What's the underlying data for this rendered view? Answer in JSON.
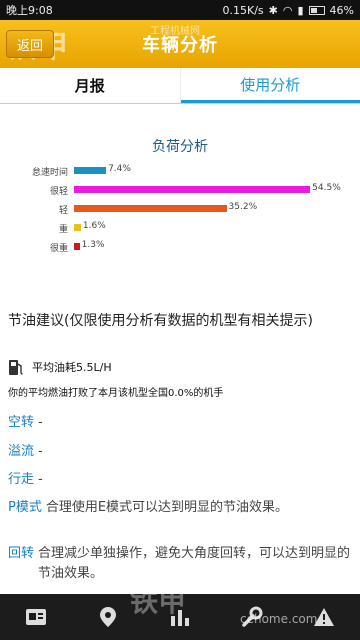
{
  "status_bar": {
    "time": "晚上9:08",
    "network_speed": "0.15K/s",
    "battery": "46%"
  },
  "header": {
    "back_label": "返回",
    "title": "车辆分析",
    "watermark": "铁甲",
    "watermark_sub": "工程机械网"
  },
  "tabs": [
    {
      "label": "月报",
      "selected": false
    },
    {
      "label": "使用分析",
      "selected": true
    }
  ],
  "chart_data": {
    "type": "bar",
    "title": "负荷分析",
    "categories": [
      "怠速时间",
      "很轻",
      "轻",
      "重",
      "很重"
    ],
    "values": [
      7.4,
      54.5,
      35.2,
      1.6,
      1.3
    ],
    "value_labels": [
      "7.4%",
      "54.5%",
      "35.2%",
      "1.6%",
      "1.3%"
    ],
    "colors": [
      "#1a8fc8",
      "#e81be0",
      "#e8571c",
      "#e8c21c",
      "#c81c1c"
    ],
    "orientation": "horizontal",
    "xlim": [
      0,
      60
    ]
  },
  "fuel": {
    "section_title": "节油建议(仅限使用分析有数据的机型有相关提示)",
    "avg_label": "平均油耗5.5L/H",
    "icon": "fuel-pump-icon",
    "compare_text": "你的平均燃油打败了本月该机型全国0.0%的机手"
  },
  "tips": [
    {
      "key": "空转",
      "value": "-"
    },
    {
      "key": "溢流",
      "value": "-"
    },
    {
      "key": "行走",
      "value": "-"
    },
    {
      "key": "P模式",
      "value": "合理使用E模式可以达到明显的节油效果。"
    },
    {
      "key": "回转",
      "value": "合理减少单独操作，避免大角度回转，可以达到明显的节油效果。"
    }
  ],
  "bottom_nav": [
    {
      "icon": "report-icon"
    },
    {
      "icon": "location-icon"
    },
    {
      "icon": "chart-icon"
    },
    {
      "icon": "wrench-icon"
    },
    {
      "icon": "alert-icon"
    }
  ],
  "bottom_watermark": "铁甲",
  "bottom_watermark_sub": "cehome.com"
}
